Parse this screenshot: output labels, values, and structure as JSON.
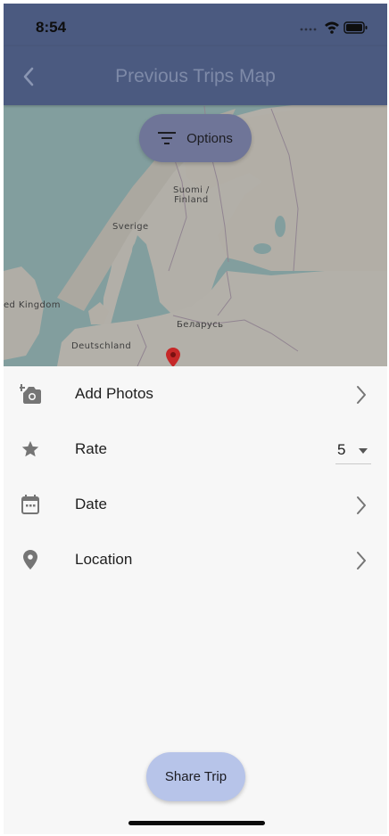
{
  "status_bar": {
    "time": "8:54",
    "icons": [
      "signal-dots-icon",
      "wifi-icon",
      "battery-icon"
    ]
  },
  "app_bar": {
    "title": "Previous Trips Map",
    "back_icon": "chevron-left-icon"
  },
  "map": {
    "options_label": "Options",
    "options_icon": "filter-lines-icon",
    "labels": {
      "finland": "Suomi /\nFinland",
      "sweden": "Sverige",
      "uk": "ed Kingdom",
      "belarus": "Беларусь",
      "germany": "Deutschland"
    },
    "marker_icon": "map-pin-icon",
    "marker_color": "#c62828"
  },
  "menu": {
    "items": [
      {
        "label": "Add Photos",
        "icon": "add-camera-icon",
        "trailing": "chevron-right-icon"
      },
      {
        "label": "Rate",
        "icon": "star-icon",
        "trailing": "dropdown",
        "value": "5"
      },
      {
        "label": "Date",
        "icon": "calendar-icon",
        "trailing": "chevron-right-icon"
      },
      {
        "label": "Location",
        "icon": "location-pin-icon",
        "trailing": "chevron-right-icon"
      }
    ]
  },
  "share_button": {
    "label": "Share Trip"
  },
  "colors": {
    "app_bar": "#4b5a80",
    "share_button": "#b7c4e9",
    "background": "#f7f7f7",
    "icon_gray": "#757575"
  }
}
